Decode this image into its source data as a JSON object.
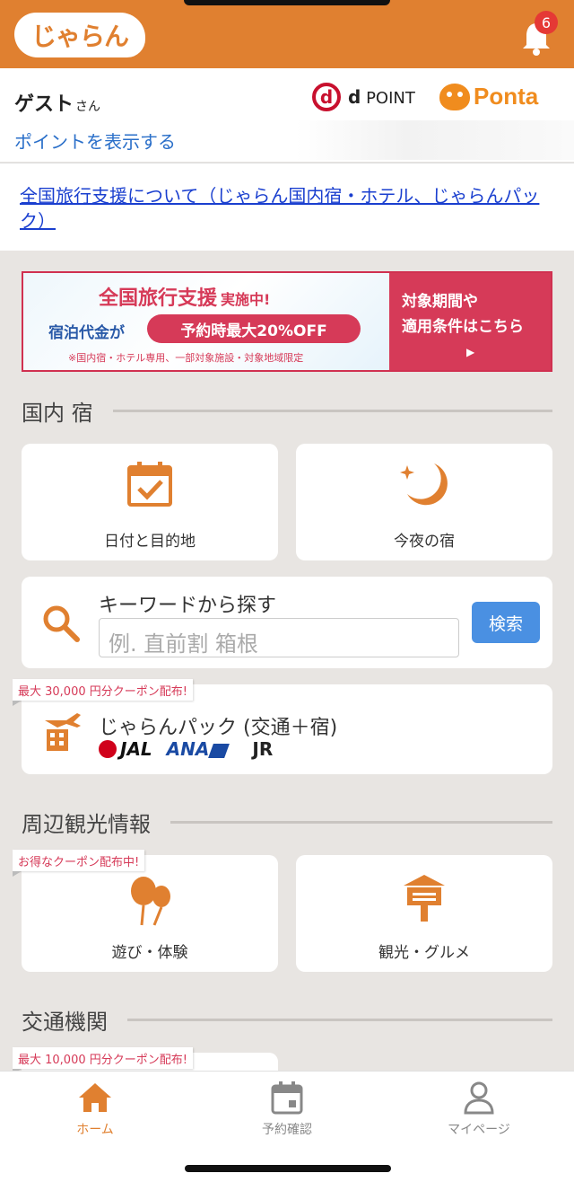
{
  "header": {
    "logo_text": "じゃらん",
    "notification_count": "6",
    "accent_color": "#e08030"
  },
  "user": {
    "name": "ゲスト",
    "honorific": "さん",
    "show_points_link": "ポイントを表示する",
    "dpoint_prefix": "d",
    "dpoint_label": "POINT",
    "ponta_label": "Ponta"
  },
  "news": {
    "link_text": "全国旅行支援について（じゃらん国内宿・ホテル、じゃらんパック）"
  },
  "banner": {
    "title": "全国旅行支援",
    "title_suffix": "実施中!",
    "subtitle": "宿泊代金が",
    "pill": "予約時最大20%OFF",
    "note": "※国内宿・ホテル専用、一部対象施設・対象地域限定",
    "right_line1": "対象期間や",
    "right_line2": "適用条件はこちら",
    "right_arrow": "▶"
  },
  "domestic": {
    "section_title": "国内 宿",
    "date_destination": "日付と目的地",
    "tonight": "今夜の宿",
    "keyword_label": "キーワードから探す",
    "keyword_placeholder": "例. 直前割 箱根",
    "search_button": "検索",
    "pack_promo": "最大 30,000 円分クーポン配布!",
    "pack_title": "じゃらんパック (交通＋宿)",
    "carriers": {
      "jal": "JAL",
      "ana": "ANA",
      "jr": "JR"
    }
  },
  "sightseeing": {
    "section_title": "周辺観光情報",
    "promo": "お得なクーポン配布中!",
    "activities": "遊び・体験",
    "gourmet": "観光・グルメ"
  },
  "transport": {
    "section_title": "交通機関",
    "promo": "最大 10,000 円分クーポン配布!"
  },
  "bottom_nav": {
    "home": "ホーム",
    "reservations": "予約確認",
    "mypage": "マイページ",
    "active_color": "#e08030",
    "inactive_color": "#888888"
  }
}
